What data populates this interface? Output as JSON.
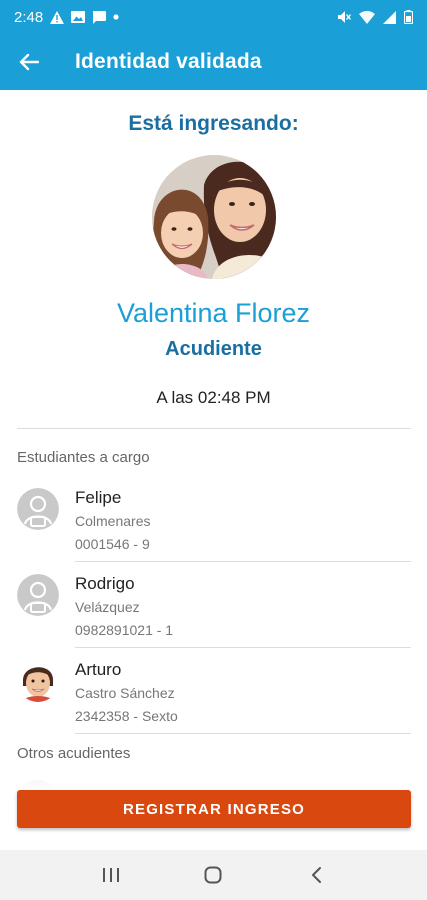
{
  "status_bar": {
    "time": "2:48",
    "icons_left": [
      "warning-icon",
      "image-icon",
      "message-icon",
      "dot-icon"
    ],
    "icons_right": [
      "mute-icon",
      "wifi-icon",
      "signal-icon",
      "battery-icon"
    ]
  },
  "app_bar": {
    "title": "Identidad validada",
    "back_icon": "arrow-left-icon",
    "color": "#1a9fd6"
  },
  "visitor": {
    "entering_label": "Está ingresando:",
    "name": "Valentina Florez",
    "role": "Acudiente",
    "time_text": "A las 02:48 PM"
  },
  "students_section": {
    "header": "Estudiantes a cargo",
    "students": [
      {
        "first_name": "Felipe",
        "last_name": "Colmenares",
        "id_text": "0001546 - 9",
        "avatar": "placeholder"
      },
      {
        "first_name": "Rodrigo",
        "last_name": "Velázquez",
        "id_text": "0982891021 - 1",
        "avatar": "placeholder"
      },
      {
        "first_name": "Arturo",
        "last_name": "Castro Sánchez",
        "id_text": "2342358 - Sexto",
        "avatar": "photo"
      }
    ]
  },
  "other_guardians_section": {
    "header": "Otros acudientes"
  },
  "register_button": {
    "label": "REGISTRAR INGRESO",
    "color": "#d9480f"
  },
  "nav_bar": {
    "buttons": [
      "recent-apps-icon",
      "home-icon",
      "back-icon"
    ]
  }
}
